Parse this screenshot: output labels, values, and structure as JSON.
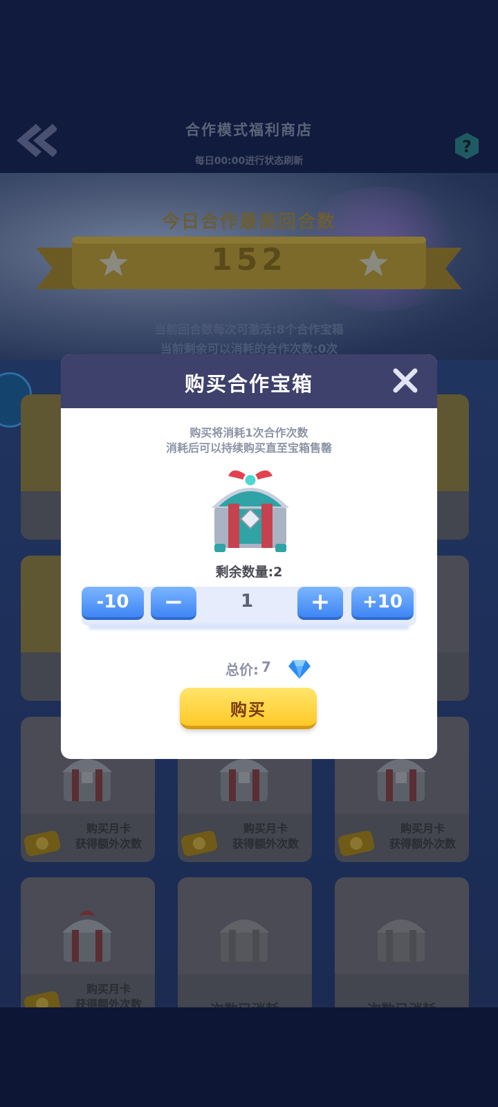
{
  "header": {
    "title": "合作模式福利商店",
    "subtitle": "每日00:00进行状态刷新"
  },
  "banner": {
    "title": "今日合作最高回合数",
    "value": "152",
    "info_line1": "当前回合数每次可激活:8个合作宝箱",
    "info_line2": "当前剩余可以消耗的合作次数:0次"
  },
  "grid": {
    "cards": [
      {
        "state": "buy_month_card",
        "text1": "购买月卡",
        "text2": "获得额外次数"
      },
      {
        "state": "buy_month_card",
        "text1": "购买月卡",
        "text2": "获得额外次数"
      },
      {
        "state": "buy_month_card",
        "text1": "购买月卡",
        "text2": "获得额外次数"
      },
      {
        "state": "buy_month_card",
        "text1": "购买月卡",
        "text2": "获得额外次数"
      },
      {
        "state": "used",
        "text1": "次数已消耗"
      },
      {
        "state": "used",
        "text1": "次数已消耗"
      }
    ]
  },
  "modal": {
    "title": "购买合作宝箱",
    "desc_line1": "购买将消耗1次合作次数",
    "desc_line2": "消耗后可以持续购买直至宝箱售罄",
    "remaining_label": "剩余数量:2",
    "quantity": "1",
    "minus10_label": "-10",
    "minus1_label": "−",
    "plus1_label": "+",
    "plus10_label": "+10",
    "total_label": "总价:",
    "total_value": "7",
    "buy_label": "购买"
  },
  "colors": {
    "modal_header": "#3d416b",
    "stepper_blue": "#4a8ef5",
    "buy_yellow": "#ffd43b",
    "gem_blue": "#3aa0ff"
  },
  "icons": {
    "back": "double-chevron-left-icon",
    "help": "question-icon",
    "close": "close-icon",
    "gem": "diamond-icon",
    "chest": "treasure-chest-icon",
    "ticket": "month-card-ticket-icon"
  }
}
